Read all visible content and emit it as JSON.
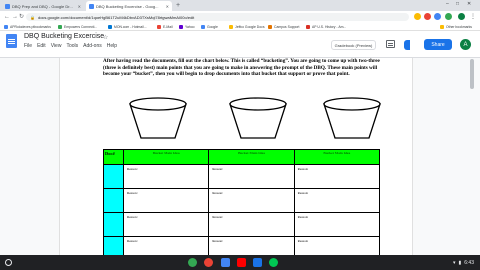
{
  "browser": {
    "tabs": [
      {
        "title": "DBQ Prep and DBQ - Google Dr...",
        "active": false
      },
      {
        "title": "DBQ Bucketing Excercise - Goog...",
        "active": true
      }
    ],
    "new_tab": "+",
    "window_controls": [
      "–",
      "□",
      "✕"
    ],
    "back": "←",
    "forward": "→",
    "reload": "↻",
    "url": "docs.google.com/document/d/1qoeHgB61T2uM4kDbvAD3TXsMql78rtgwaMmAI00o/edit",
    "bookmarks": [
      {
        "label": "APRolodexes ptbookmarks",
        "color": "#4285f4"
      },
      {
        "label": "Empowers Connecti...",
        "color": "#34a853"
      },
      {
        "label": "MON.com - Hotmail...",
        "color": "#0078d4"
      },
      {
        "label": "E-Mail",
        "color": "#ea4335"
      },
      {
        "label": "Yahoo",
        "color": "#6001d2"
      },
      {
        "label": "Google",
        "color": "#4285f4"
      },
      {
        "label": "Jeffco Google Docs",
        "color": "#fbbc04"
      },
      {
        "label": "Campus Support",
        "color": "#e37400"
      },
      {
        "label": "AP U.S. History - Am...",
        "color": "#d93025"
      },
      {
        "label": "Other bookmarks",
        "color": "#fbbc04"
      }
    ]
  },
  "docs": {
    "title": "DBQ Bucketing Excercise",
    "menu": [
      "File",
      "Edit",
      "View",
      "Tools",
      "Add-ons",
      "Help"
    ],
    "present_label": "Gradebook (Preview)",
    "share_label": "Share",
    "avatar_letter": "A"
  },
  "document": {
    "instructions": "After having read the documents, fill out the chart below. This is called “bucketing”. You are going to come up with two-three (three is definitely best) main points that you are going to make in answering the prompt of the DBQ. These main points will become your “bucket”, then you will begin to drop documents into that bucket that support or prove that point.",
    "table": {
      "header_doc": "Doc#",
      "bucket_headers": [
        "Bucket Main Idea",
        "Bucket Main Idea",
        "Bucket Main Idea"
      ],
      "reason_label": "Reason:",
      "rows": 4
    }
  },
  "shelf": {
    "apps": [
      {
        "name": "chrome",
        "color": "#34a853"
      },
      {
        "name": "gmail",
        "color": "#ea4335"
      },
      {
        "name": "docs",
        "color": "#4285f4"
      },
      {
        "name": "youtube",
        "color": "#ff0000"
      },
      {
        "name": "files",
        "color": "#1a73e8"
      },
      {
        "name": "play",
        "color": "#00c853"
      }
    ],
    "clock": "6:43"
  },
  "colors": {
    "header_green": "#00ff00",
    "doc_column_cyan": "#00ffff",
    "share_blue": "#1a73e8"
  }
}
